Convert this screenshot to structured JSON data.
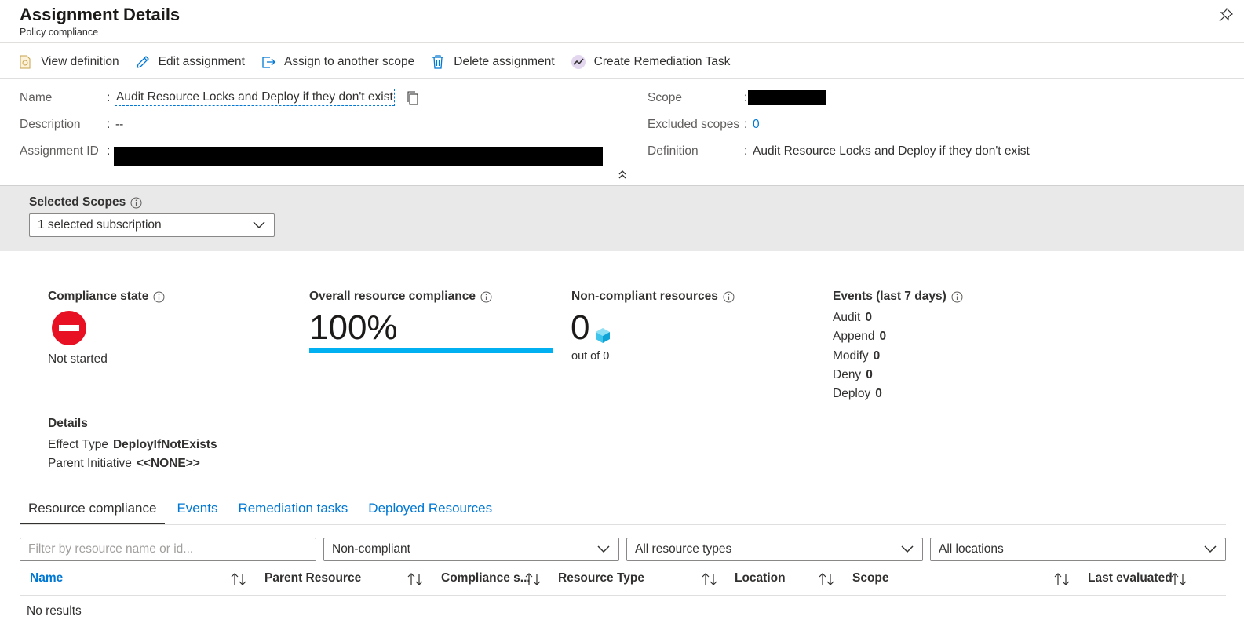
{
  "header": {
    "title": "Assignment Details",
    "subtitle": "Policy compliance"
  },
  "toolbar": {
    "view_definition": "View definition",
    "edit_assignment": "Edit assignment",
    "assign_scope": "Assign to another scope",
    "delete_assignment": "Delete assignment",
    "create_remediation": "Create Remediation Task"
  },
  "essentials": {
    "name_label": "Name",
    "name_value": "Audit Resource Locks and Deploy if they don't exist",
    "description_label": "Description",
    "description_value": "--",
    "assignment_id_label": "Assignment ID",
    "scope_label": "Scope",
    "excluded_label": "Excluded scopes",
    "excluded_value": "0",
    "definition_label": "Definition",
    "definition_value": "Audit Resource Locks and Deploy if they don't exist",
    "colon": ":"
  },
  "scopes": {
    "label": "Selected Scopes",
    "selected": "1 selected subscription"
  },
  "summary": {
    "compliance_state_label": "Compliance state",
    "compliance_state_value": "Not started",
    "overall_label": "Overall resource compliance",
    "overall_value": "100%",
    "overall_fraction": 1.0,
    "noncompliant_label": "Non-compliant resources",
    "noncompliant_value": "0",
    "noncompliant_outof": "out of 0",
    "events_label": "Events (last 7 days)",
    "events": [
      {
        "label": "Audit",
        "value": "0"
      },
      {
        "label": "Append",
        "value": "0"
      },
      {
        "label": "Modify",
        "value": "0"
      },
      {
        "label": "Deny",
        "value": "0"
      },
      {
        "label": "Deploy",
        "value": "0"
      }
    ]
  },
  "details": {
    "title": "Details",
    "effect_label": "Effect Type",
    "effect_value": "DeployIfNotExists",
    "parent_label": "Parent Initiative",
    "parent_value": "<<NONE>>"
  },
  "tabs": [
    {
      "label": "Resource compliance",
      "active": true
    },
    {
      "label": "Events",
      "active": false
    },
    {
      "label": "Remediation tasks",
      "active": false
    },
    {
      "label": "Deployed Resources",
      "active": false
    }
  ],
  "filters": {
    "search_placeholder": "Filter by resource name or id...",
    "compliance_filter": "Non-compliant",
    "type_filter": "All resource types",
    "location_filter": "All locations"
  },
  "table": {
    "columns": [
      "Name",
      "Parent Resource",
      "Compliance s...",
      "Resource Type",
      "Location",
      "Scope",
      "Last evaluated"
    ],
    "empty_text": "No results"
  },
  "colors": {
    "accent": "#0078d4",
    "progress": "#00b0f0",
    "error": "#e81123",
    "band": "#e9e9e9"
  },
  "icons": {
    "pin": "pin-icon",
    "view_definition": "document-icon",
    "edit": "pencil-icon",
    "assign": "export-icon",
    "delete": "trash-icon",
    "remediation": "chart-trend-icon",
    "copy": "copy-icon",
    "collapse": "double-chevron-up-icon",
    "info": "info-icon",
    "not_started": "blocked-icon",
    "resource": "cube-icon",
    "sort": "sort-icon"
  }
}
